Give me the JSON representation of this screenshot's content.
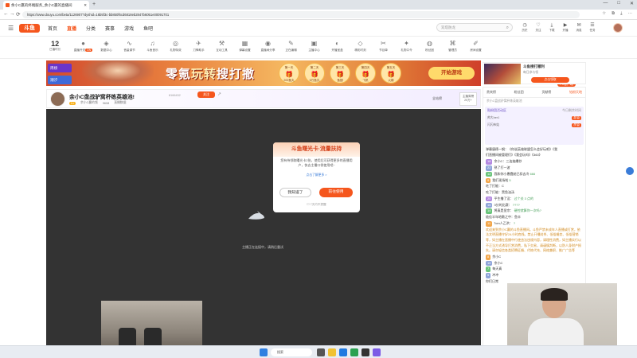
{
  "browser": {
    "tab_title": "余小C赢的终端服务_余小C赢的直播间",
    "new_tab": "+",
    "url": "https://www.douyu.com/beta/1126907?dyshid=16b5f3c-bb850f6cd6818eb2847b6051e00091701",
    "window_controls": [
      "—",
      "□",
      "✕"
    ],
    "nav": {
      "back": "←",
      "forward": "→",
      "refresh": "⟳"
    }
  },
  "header": {
    "logo": "斗鱼",
    "nav": [
      "首页",
      "直播",
      "分类",
      "赛事",
      "游戏",
      "鱼吧"
    ],
    "active_nav": "直播",
    "search_placeholder": "双塔防龙",
    "tools": [
      {
        "icon": "history-icon",
        "glyph": "◷",
        "label": "历史"
      },
      {
        "icon": "heart-icon",
        "glyph": "♡",
        "label": "关注"
      },
      {
        "icon": "download-icon",
        "glyph": "⤓",
        "label": "下载"
      },
      {
        "icon": "play-icon",
        "glyph": "▶",
        "label": "开播"
      },
      {
        "icon": "message-icon",
        "glyph": "✉",
        "label": "消息"
      },
      {
        "icon": "task-icon",
        "glyph": "☰",
        "label": "任务"
      }
    ]
  },
  "categories": {
    "clock_num": "12",
    "clock_label": "已播时长",
    "items": [
      {
        "glyph": "●",
        "label": "直播开关",
        "badge": "ON"
      },
      {
        "glyph": "◈",
        "label": "数据中心"
      },
      {
        "glyph": "∿",
        "label": "音量调节"
      },
      {
        "glyph": "♫",
        "label": "斗鱼音乐"
      },
      {
        "glyph": "◎",
        "label": "礼物特效"
      },
      {
        "glyph": "✈",
        "label": "刀锋助手"
      },
      {
        "glyph": "⚒",
        "label": "互动工具"
      },
      {
        "glyph": "▦",
        "label": "弹幕设置"
      },
      {
        "glyph": "◉",
        "label": "直播间分享"
      },
      {
        "glyph": "✎",
        "label": "正在编辑"
      },
      {
        "glyph": "▣",
        "label": "主播中心"
      },
      {
        "glyph": "◐",
        "label": "开播宝盒"
      },
      {
        "glyph": "◇",
        "label": "精彩时刻"
      },
      {
        "glyph": "✂",
        "label": "节目单"
      },
      {
        "glyph": "✦",
        "label": "礼物口令"
      },
      {
        "glyph": "◍",
        "label": "粉丝团"
      },
      {
        "glyph": "⌘",
        "label": "管理员"
      },
      {
        "glyph": "✐",
        "label": "房间设置"
      }
    ]
  },
  "banner": {
    "tag1": "周榜",
    "tag2": "潮汐",
    "title_a": "零氪",
    "title_b": "玩转",
    "title_c": "搜打撤",
    "rewards": [
      {
        "day": "第一天",
        "name": "200鱼丸"
      },
      {
        "day": "第二天",
        "name": "6万鱼丸"
      },
      {
        "day": "第三天",
        "name": "鱼翅"
      },
      {
        "day": "第四天",
        "name": "飞机"
      },
      {
        "day": "第五天",
        "name": "火箭"
      }
    ],
    "cta": "开始游戏"
  },
  "right_ad": {
    "title": "斗鱼搜打撤利",
    "subtitle": "每日参与领",
    "button": "点击领取",
    "pc_badge": "PC客户端"
  },
  "room": {
    "title": "余小C盘战驴窝杯练英雄池!",
    "id": "8166432",
    "follow": "关注",
    "share": "↗",
    "level": "Lv",
    "streamer": "余小C赢的频",
    "stat1": "9608",
    "stat2": "直播数据",
    "rank_title": "主播周榜",
    "rank_value": "20万+",
    "quanzhan": "全站榜"
  },
  "popup": {
    "title": "斗鱼曙光卡·流量扶持",
    "body": "您有待领取曙光卡2张，使用后可获得更多的直播用户，快去主播口袋使用吧~",
    "link": "点击了解更多 >",
    "btn_know": "我知道了",
    "btn_go": "前往使用",
    "checkbox": "7天内不提醒"
  },
  "video": {
    "message": "主播正在连接中，请稍后重试"
  },
  "chat": {
    "tabs": [
      "贵宾榜",
      "粉丝团",
      "贡献榜",
      "钻粉天地"
    ],
    "active_tab": "钻粉天地",
    "notice": "余小C盘战驴窝杯练英雄池",
    "fans_header": "贴粉团活动区",
    "fans_time": "今日剩余时间",
    "fans_rows": [
      {
        "name": "帅大ber1",
        "tag": "超管"
      },
      {
        "name": "闪闪布娃",
        "tag": "房管"
      }
    ],
    "messages": [
      {
        "lv": "",
        "cls": "",
        "name": "弹幕",
        "text": "唐德一钢：《你说英雄联盟怎么会好玩吧》《我"
      },
      {
        "lv": "",
        "cls": "",
        "name": "",
        "text": "们直播间被管理们》《我会玩吗》《360》"
      },
      {
        "lv": "18",
        "cls": "p",
        "name": "余小C：",
        "text": "三连抽爆抄",
        "hi": ""
      },
      {
        "lv": "22",
        "cls": "",
        "name": "",
        "text": "熟了打一波",
        "hi": ""
      },
      {
        "lv": "12",
        "cls": "g",
        "name": "我和你小愚蠢",
        "text": "她已扣去冷",
        "hi": "666"
      },
      {
        "lv": "9",
        "cls": "o",
        "name": "",
        "text": "我们现场啦",
        "hi": "5"
      },
      {
        "lv": "",
        "cls": "",
        "name": "",
        "text": "吃了打能：C",
        "hi": ""
      },
      {
        "lv": "",
        "cls": "",
        "name": "",
        "text": "吃了打能：黑鱼油汤",
        "hi": ""
      },
      {
        "lv": "20",
        "cls": "p",
        "name": "",
        "text": "平生撸了没：",
        "hi": "过个关 3 点的"
      },
      {
        "lv": "16",
        "cls": "",
        "name": "",
        "text": "3分的比赛：",
        "hi": "????"
      },
      {
        "lv": "14",
        "cls": "g",
        "name": "",
        "text": "将真是显宗：",
        "hi": "硬控就算你一次吗?"
      },
      {
        "lv": "",
        "cls": "",
        "name": "",
        "text": "极佳半年地歌之中：鱼丰",
        "hi": ""
      },
      {
        "lv": "11",
        "cls": "o",
        "name": "",
        "text": "7cm人乙洪：",
        "hi": "?"
      }
    ],
    "system_notice": "欢迎来到余小C赢的斗鱼直播间。斗鱼严禁未成年人直播或打赏，依法文明直播守好24小时底线。禁止开播封杀、低俗婚恋、低俗营销等，如主播在直播中行使违法违规内容，请理性消费，如主播实行以不正当方式诱导打赏消费，私下交易，请谨慎判断，以防人身财产损失。请勿轻信各类招聘征婚、代练代充、网络兼职、推广广告等",
    "tail_messages": [
      {
        "lv": "8",
        "cls": "o",
        "name": "",
        "text": "余小C"
      },
      {
        "lv": "10",
        "cls": "",
        "name": "",
        "text": "余小C"
      },
      {
        "lv": "7",
        "cls": "g",
        "name": "",
        "text": "每天真"
      },
      {
        "lv": "5",
        "cls": "",
        "name": "",
        "text": "冲冲"
      },
      {
        "lv": "",
        "cls": "",
        "name": "",
        "text": "你们日常"
      }
    ]
  },
  "taskbar": {
    "search": "搜索"
  }
}
